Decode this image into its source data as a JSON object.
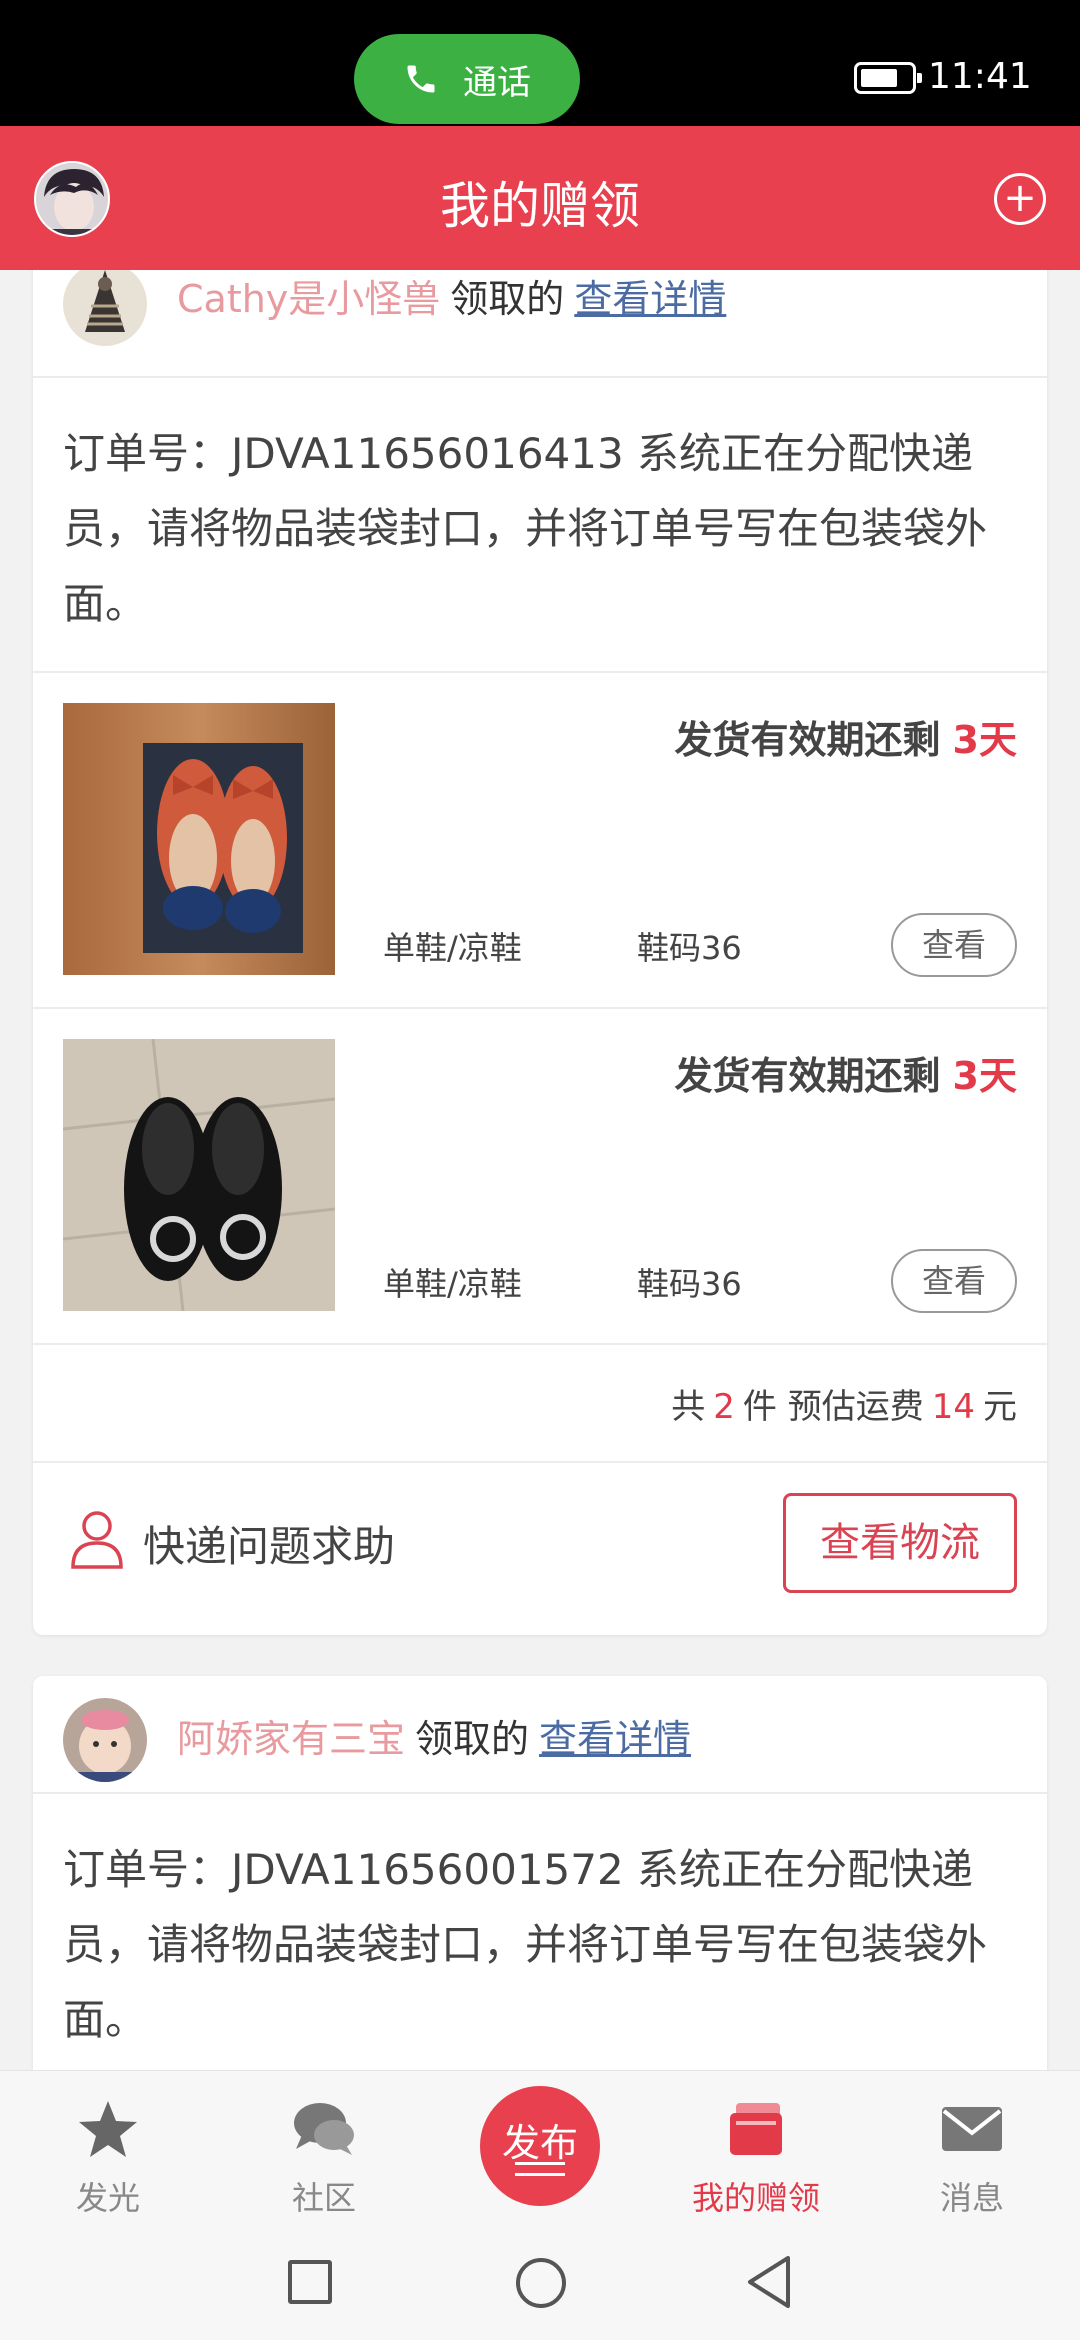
{
  "status_bar": {
    "call_label": "通话",
    "time": "11:41"
  },
  "header": {
    "title": "我的赠领"
  },
  "orders": [
    {
      "giver": "Cathy是小怪兽",
      "received_text": "领取的",
      "detail_link": "查看详情",
      "order_text": "订单号：JDVA11656016413 系统正在分配快递员，请将物品装袋封口，并将订单号写在包装袋外面。",
      "items": [
        {
          "deadline_label": "发货有效期还剩",
          "days": "3天",
          "category": "单鞋/凉鞋",
          "size": "鞋码36",
          "view_label": "查看"
        },
        {
          "deadline_label": "发货有效期还剩",
          "days": "3天",
          "category": "单鞋/凉鞋",
          "size": "鞋码36",
          "view_label": "查看"
        }
      ],
      "summary": {
        "prefix": "共",
        "count": "2",
        "count_unit": "件 预估运费",
        "fee": "14",
        "fee_unit": "元"
      },
      "help_label": "快递问题求助",
      "logistics_label": "查看物流"
    },
    {
      "giver": "阿娇家有三宝",
      "received_text": "领取的",
      "detail_link": "查看详情",
      "order_text": "订单号：JDVA11656001572 系统正在分配快递员，请将物品装袋封口，并将订单号写在包装袋外面。"
    }
  ],
  "bottom_nav": {
    "items": [
      {
        "label": "发光",
        "icon": "star-icon"
      },
      {
        "label": "社区",
        "icon": "chat-bubbles-icon"
      },
      {
        "label": "我的赠领",
        "icon": "wallet-icon"
      },
      {
        "label": "消息",
        "icon": "mail-icon"
      }
    ],
    "publish_label": "发布",
    "active": "我的赠领"
  },
  "colors": {
    "brand_red": "#e8404f",
    "accent_red": "#e33a4a",
    "giver_pink": "#e89a9e",
    "link_blue": "#4d6ba3",
    "call_green": "#3cb043"
  }
}
